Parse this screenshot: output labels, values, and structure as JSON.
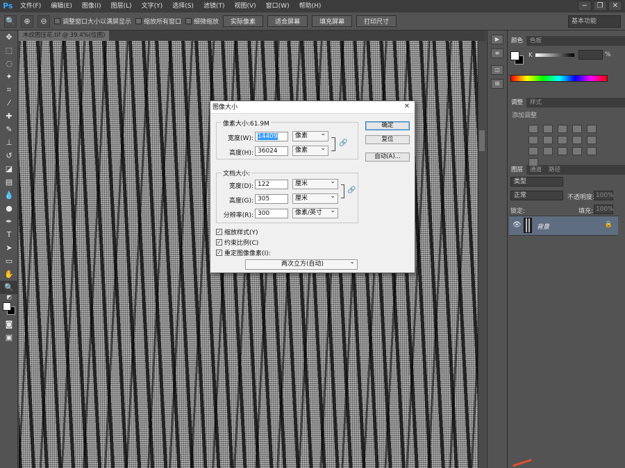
{
  "app": {
    "logo": "Ps"
  },
  "menu": [
    "文件(F)",
    "编辑(E)",
    "图像(I)",
    "图层(L)",
    "文字(Y)",
    "选择(S)",
    "滤镜(T)",
    "视图(V)",
    "窗口(W)",
    "帮助(H)"
  ],
  "window_controls": {
    "minimize": "−",
    "restore": "❐",
    "close": "✕"
  },
  "options_bar": {
    "resize_windows": "调整窗口大小以满屏显示",
    "zoom_all": "缩放所有窗口",
    "scrubby_zoom": "细微缩放",
    "actual_pixels": "实际像素",
    "fit_screen": "适合屏幕",
    "fill_screen": "填充屏幕",
    "print_size": "打印尺寸",
    "workspace": "基本功能"
  },
  "document": {
    "tab": "木纹图压花.tif @ 39.4%(位图)"
  },
  "panels": {
    "color_tabs": [
      "颜色",
      "色板"
    ],
    "k_label": "K",
    "percent": "%",
    "adjust_tabs": [
      "调整",
      "样式"
    ],
    "add_adjustment": "添加调整",
    "layer_tabs": [
      "图层",
      "通道",
      "路径"
    ],
    "kind_filter": "类型",
    "blend_mode": "正常",
    "opacity_label": "不透明度:",
    "opacity_value": "100%",
    "lock_label": "锁定:",
    "fill_label": "填充:",
    "fill_value": "100%",
    "layer_name": "背景"
  },
  "dialog": {
    "title": "图像大小",
    "pixel_dimensions": "像素大小:61.9M",
    "width_label": "宽度(W):",
    "width_value": "14409",
    "width_unit": "像素",
    "height_label": "高度(H):",
    "height_value": "36024",
    "height_unit": "像素",
    "doc_size": "文档大小:",
    "doc_width_label": "宽度(D):",
    "doc_width_value": "122",
    "doc_width_unit": "厘米",
    "doc_height_label": "高度(G):",
    "doc_height_value": "305",
    "doc_height_unit": "厘米",
    "resolution_label": "分辨率(R):",
    "resolution_value": "300",
    "resolution_unit": "像素/英寸",
    "scale_styles": "缩放样式(Y)",
    "constrain": "约束比例(C)",
    "resample": "重定图像像素(I):",
    "resample_method": "两次立方(自动)",
    "ok": "确定",
    "reset": "复位",
    "auto": "自动(A)..."
  }
}
